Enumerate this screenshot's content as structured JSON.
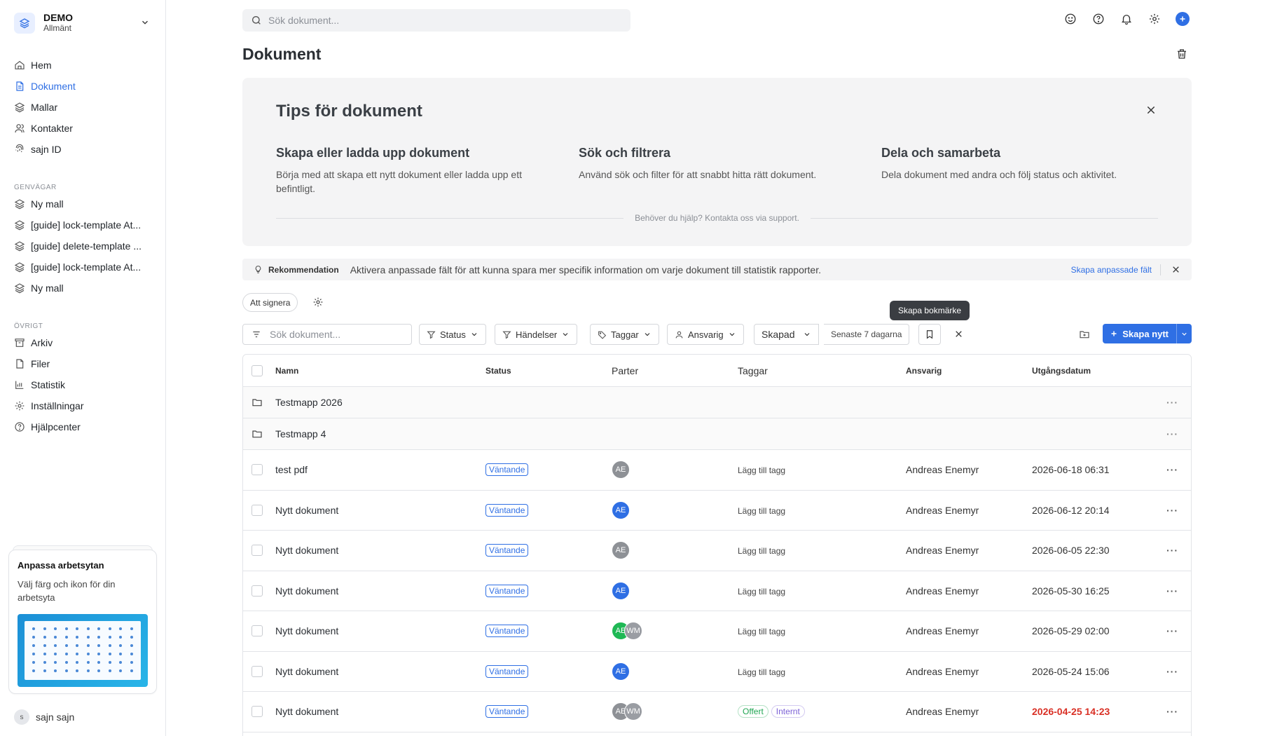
{
  "workspace": {
    "name": "DEMO",
    "subtitle": "Allmänt"
  },
  "nav": [
    {
      "label": "Hem",
      "icon": "home-icon",
      "active": false
    },
    {
      "label": "Dokument",
      "icon": "document-icon",
      "active": true
    },
    {
      "label": "Mallar",
      "icon": "layers-icon",
      "active": false
    },
    {
      "label": "Kontakter",
      "icon": "contacts-icon",
      "active": false
    },
    {
      "label": "sajn ID",
      "icon": "fingerprint-icon",
      "active": false
    }
  ],
  "shortcuts": {
    "title": "GENVÄGAR",
    "items": [
      {
        "label": "Ny mall"
      },
      {
        "label": "[guide] lock-template At..."
      },
      {
        "label": "[guide] delete-template ..."
      },
      {
        "label": "[guide] lock-template At..."
      },
      {
        "label": "Ny mall"
      }
    ]
  },
  "other": {
    "title": "ÖVRIGT",
    "items": [
      {
        "label": "Arkiv",
        "icon": "archive-icon"
      },
      {
        "label": "Filer",
        "icon": "file-icon"
      },
      {
        "label": "Statistik",
        "icon": "chart-icon"
      },
      {
        "label": "Inställningar",
        "icon": "gear-icon"
      },
      {
        "label": "Hjälpcenter",
        "icon": "help-icon"
      }
    ]
  },
  "customize_card": {
    "title": "Anpassa arbetsytan",
    "desc": "Välj färg och ikon för din arbetsyta"
  },
  "user": {
    "initial": "s",
    "name": "sajn sajn"
  },
  "top": {
    "search_placeholder": "Sök dokument..."
  },
  "page": {
    "title": "Dokument"
  },
  "tips": {
    "title": "Tips för dokument",
    "items": [
      {
        "title": "Skapa eller ladda upp dokument",
        "desc": "Börja med att skapa ett nytt dokument eller ladda upp ett befintligt."
      },
      {
        "title": "Sök och filtrera",
        "desc": "Använd sök och filter för att snabbt hitta rätt dokument."
      },
      {
        "title": "Dela och samarbeta",
        "desc": "Dela dokument med andra och följ status och aktivitet."
      }
    ],
    "help": "Behöver du hjälp? Kontakta oss via support."
  },
  "recommendation": {
    "label": "Rekommendation",
    "text": "Aktivera anpassade fält för att kunna spara mer specifik information om varje dokument till statistik rapporter.",
    "link": "Skapa anpassade fält"
  },
  "chips": {
    "sign": "Att signera"
  },
  "tooltip": "Skapa bokmärke",
  "filters": {
    "search_placeholder": "Sök dokument...",
    "status": "Status",
    "events": "Händelser",
    "tags": "Taggar",
    "responsible": "Ansvarig",
    "created": "Skapad",
    "range": "Senaste 7 dagarna",
    "create": "Skapa nytt"
  },
  "table": {
    "headers": {
      "name": "Namn",
      "status": "Status",
      "parter": "Parter",
      "tags": "Taggar",
      "responsible": "Ansvarig",
      "expires": "Utgångsdatum"
    },
    "folders": [
      {
        "name": "Testmapp 2026"
      },
      {
        "name": "Testmapp 4"
      }
    ],
    "rows": [
      {
        "name": "test pdf",
        "status": "Väntande",
        "avatars": [
          {
            "initials": "AE",
            "color": "#8e9196"
          }
        ],
        "tag_add": "Lägg till tagg",
        "tags": [],
        "responsible": "Andreas Enemyr",
        "date": "2026-06-18 06:31",
        "overdue": false
      },
      {
        "name": "Nytt dokument",
        "status": "Väntande",
        "avatars": [
          {
            "initials": "AE",
            "color": "#2f6fe4"
          }
        ],
        "tag_add": "Lägg till tagg",
        "tags": [],
        "responsible": "Andreas Enemyr",
        "date": "2026-06-12 20:14",
        "overdue": false
      },
      {
        "name": "Nytt dokument",
        "status": "Väntande",
        "avatars": [
          {
            "initials": "AE",
            "color": "#8e9196"
          }
        ],
        "tag_add": "Lägg till tagg",
        "tags": [],
        "responsible": "Andreas Enemyr",
        "date": "2026-06-05 22:30",
        "overdue": false
      },
      {
        "name": "Nytt dokument",
        "status": "Väntande",
        "avatars": [
          {
            "initials": "AE",
            "color": "#2f6fe4"
          }
        ],
        "tag_add": "Lägg till tagg",
        "tags": [],
        "responsible": "Andreas Enemyr",
        "date": "2026-05-30 16:25",
        "overdue": false
      },
      {
        "name": "Nytt dokument",
        "status": "Väntande",
        "avatars": [
          {
            "initials": "AE",
            "color": "#1fb855"
          },
          {
            "initials": "WM",
            "color": "#9a9da3"
          }
        ],
        "tag_add": "Lägg till tagg",
        "tags": [],
        "responsible": "Andreas Enemyr",
        "date": "2026-05-29 02:00",
        "overdue": false
      },
      {
        "name": "Nytt dokument",
        "status": "Väntande",
        "avatars": [
          {
            "initials": "AE",
            "color": "#2f6fe4"
          }
        ],
        "tag_add": "Lägg till tagg",
        "tags": [],
        "responsible": "Andreas Enemyr",
        "date": "2026-05-24 15:06",
        "overdue": false
      },
      {
        "name": "Nytt dokument",
        "status": "Väntande",
        "avatars": [
          {
            "initials": "AE",
            "color": "#8e9196"
          },
          {
            "initials": "WM",
            "color": "#9a9da3"
          }
        ],
        "tag_add": "",
        "tags": [
          {
            "label": "Offert",
            "color": "#1fa652"
          },
          {
            "label": "Internt",
            "color": "#7b5fd6"
          }
        ],
        "responsible": "Andreas Enemyr",
        "date": "2026-04-25 14:23",
        "overdue": true
      }
    ]
  },
  "colors": {
    "accent": "#2f6fe4",
    "overdue": "#d93025"
  }
}
